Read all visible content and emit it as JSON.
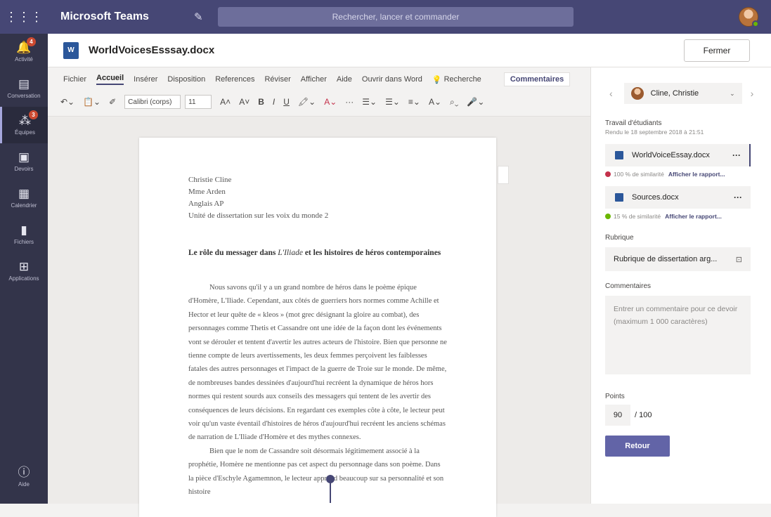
{
  "app": {
    "title": "Microsoft Teams",
    "search_placeholder": "Rechercher, lancer et commander"
  },
  "rail": [
    {
      "label": "Activité",
      "icon": "bell-icon",
      "badge": "4"
    },
    {
      "label": "Conversation",
      "icon": "chat-icon",
      "badge": ""
    },
    {
      "label": "Équipes",
      "icon": "teams-icon",
      "badge": "3"
    },
    {
      "label": "Devoirs",
      "icon": "assignments-icon",
      "badge": ""
    },
    {
      "label": "Calendrier",
      "icon": "calendar-icon",
      "badge": ""
    },
    {
      "label": "Fichiers",
      "icon": "files-icon",
      "badge": ""
    },
    {
      "label": "Applications",
      "icon": "apps-icon",
      "badge": ""
    }
  ],
  "rail_help": "Aide",
  "document": {
    "name": "WorldVoicesEsssay.docx",
    "close_label": "Fermer"
  },
  "ribbon": {
    "tabs": [
      "Fichier",
      "Accueil",
      "Insérer",
      "Disposition",
      "References",
      "Réviser",
      "Afficher",
      "Aide",
      "Ouvrir dans Word",
      "Recherche"
    ],
    "comments_label": "Commentaires",
    "font": "Calibri (corps)",
    "size": "11"
  },
  "page": {
    "address": [
      "Christie Cline",
      "Mme Arden",
      "Anglais AP",
      "Unité de dissertation sur les voix du monde 2"
    ],
    "title_start": "Le rôle du messager dans ",
    "title_italic": "L'Iliade",
    "title_end": " et les histoires de héros contemporaines",
    "para1": "Nous savons qu'il y a un grand nombre de héros dans le poème épique d'Homère, L'Iliade. Cependant, aux côtés de guerriers hors normes comme Achille et Hector et leur quête de « kleos » (mot grec désignant la gloire au combat), des personnages comme Thetis et Cassandre ont une idée de la façon dont les événements vont se dérouler et tentent d'avertir les autres acteurs de l'histoire. Bien que personne ne tienne compte de leurs avertissements, les deux femmes perçoivent les faiblesses fatales des autres personnages et l'impact de la guerre de Troie sur le monde. De même, de nombreuses bandes dessinées d'aujourd'hui recréent la dynamique de héros hors normes qui restent sourds aux conseils des messagers qui tentent de les avertir des conséquences de leurs décisions. En regardant ces exemples côte à côte, le lecteur peut voir qu'un vaste éventail d'histoires de héros d'aujourd'hui recréent les anciens schémas de narration de L'Iliade d'Homère et des mythes connexes.",
    "para2": "Bien que le nom de Cassandre soit désormais légitimement associé à la prophétie, Homère ne mentionne pas cet aspect du personnage dans son poème. Dans la pièce d'Eschyle Agamemnon, le lecteur apprend beaucoup sur sa personnalité et son histoire"
  },
  "panel": {
    "student_name": "Cline, Christie",
    "work_label": "Travail d'étudiants",
    "submitted": "Rendu le 18 septembre 2018 à 21:51",
    "files": [
      {
        "name": "WorldVoiceEssay.docx",
        "similarity": "100 % de similarité",
        "color": "#c4314b"
      },
      {
        "name": "Sources.docx",
        "similarity": "15 % de similarité",
        "color": "#6bb700"
      }
    ],
    "report_link": "Afficher le rapport...",
    "rubric_label": "Rubrique",
    "rubric_value": "Rubrique de dissertation arg...",
    "comments_label": "Commentaires",
    "comments_placeholder": "Entrer un commentaire pour ce devoir (maximum 1 000 caractères)",
    "points_label": "Points",
    "points_value": "90",
    "points_max": "/ 100",
    "return_label": "Retour"
  },
  "colors": {
    "titlebar": "#464775",
    "rail": "#33344a",
    "accent": "#6264a7"
  }
}
